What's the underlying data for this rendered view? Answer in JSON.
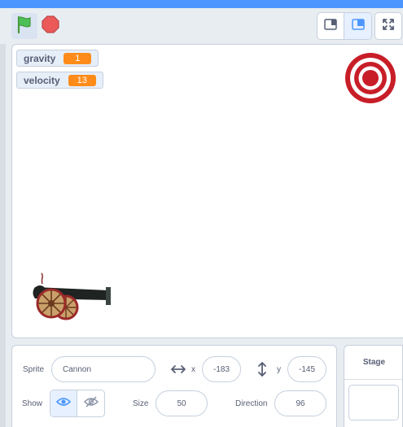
{
  "monitors": [
    {
      "label": "gravity",
      "value": "1"
    },
    {
      "label": "velocity",
      "value": "13"
    }
  ],
  "sprite_info": {
    "sprite_label": "Sprite",
    "name": "Cannon",
    "x_label": "x",
    "x_value": "-183",
    "y_label": "y",
    "y_value": "-145",
    "show_label": "Show",
    "size_label": "Size",
    "size_value": "50",
    "direction_label": "Direction",
    "direction_value": "96"
  },
  "stage_panel": {
    "title": "Stage"
  },
  "icons": {
    "flag": "green-flag-icon",
    "stop": "stop-icon",
    "small_stage": "small-stage-icon",
    "normal_stage": "normal-stage-icon",
    "fullscreen": "fullscreen-icon",
    "show_visible": "eye-icon",
    "show_hidden": "eye-slash-icon",
    "x_axis": "horizontal-arrows-icon",
    "y_axis": "vertical-arrows-icon"
  },
  "colors": {
    "accent": "#4c97ff",
    "monitor_value": "#ff8c1a",
    "flag": "#4cbf56",
    "stop": "#ec5959",
    "target_red": "#c81e28"
  }
}
